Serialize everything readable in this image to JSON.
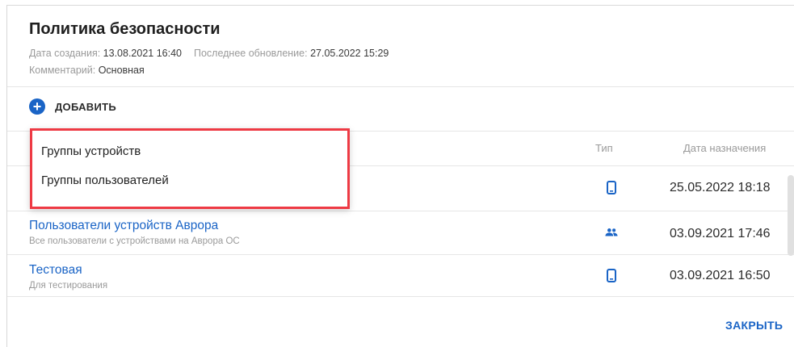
{
  "dialog": {
    "title": "Политика безопасности",
    "created_label": "Дата создания:",
    "created_value": "13.08.2021 16:40",
    "updated_label": "Последнее обновление:",
    "updated_value": "27.05.2022 15:29",
    "comment_label": "Комментарий:",
    "comment_value": "Основная",
    "close_label": "ЗАКРЫТЬ"
  },
  "toolbar": {
    "add_label": "ДОБАВИТЬ",
    "add_icon": "plus-circle-icon"
  },
  "table": {
    "columns": [
      "Тип",
      "Дата назначения"
    ],
    "rows": [
      {
        "name": "",
        "description": "",
        "type_icon": "smartphone-icon",
        "date": "25.05.2022 18:18"
      },
      {
        "name": "Пользователи устройств Аврора",
        "description": "Все пользователи с устройствами на Аврора ОС",
        "type_icon": "users-icon",
        "date": "03.09.2021 17:46"
      },
      {
        "name": "Тестовая",
        "description": "Для тестирования",
        "type_icon": "smartphone-icon",
        "date": "03.09.2021 16:50"
      }
    ]
  },
  "dropdown": {
    "items": [
      "Группы устройств",
      "Группы пользователей"
    ]
  },
  "colors": {
    "accent": "#1a64c6",
    "highlight": "#ee3a44"
  }
}
